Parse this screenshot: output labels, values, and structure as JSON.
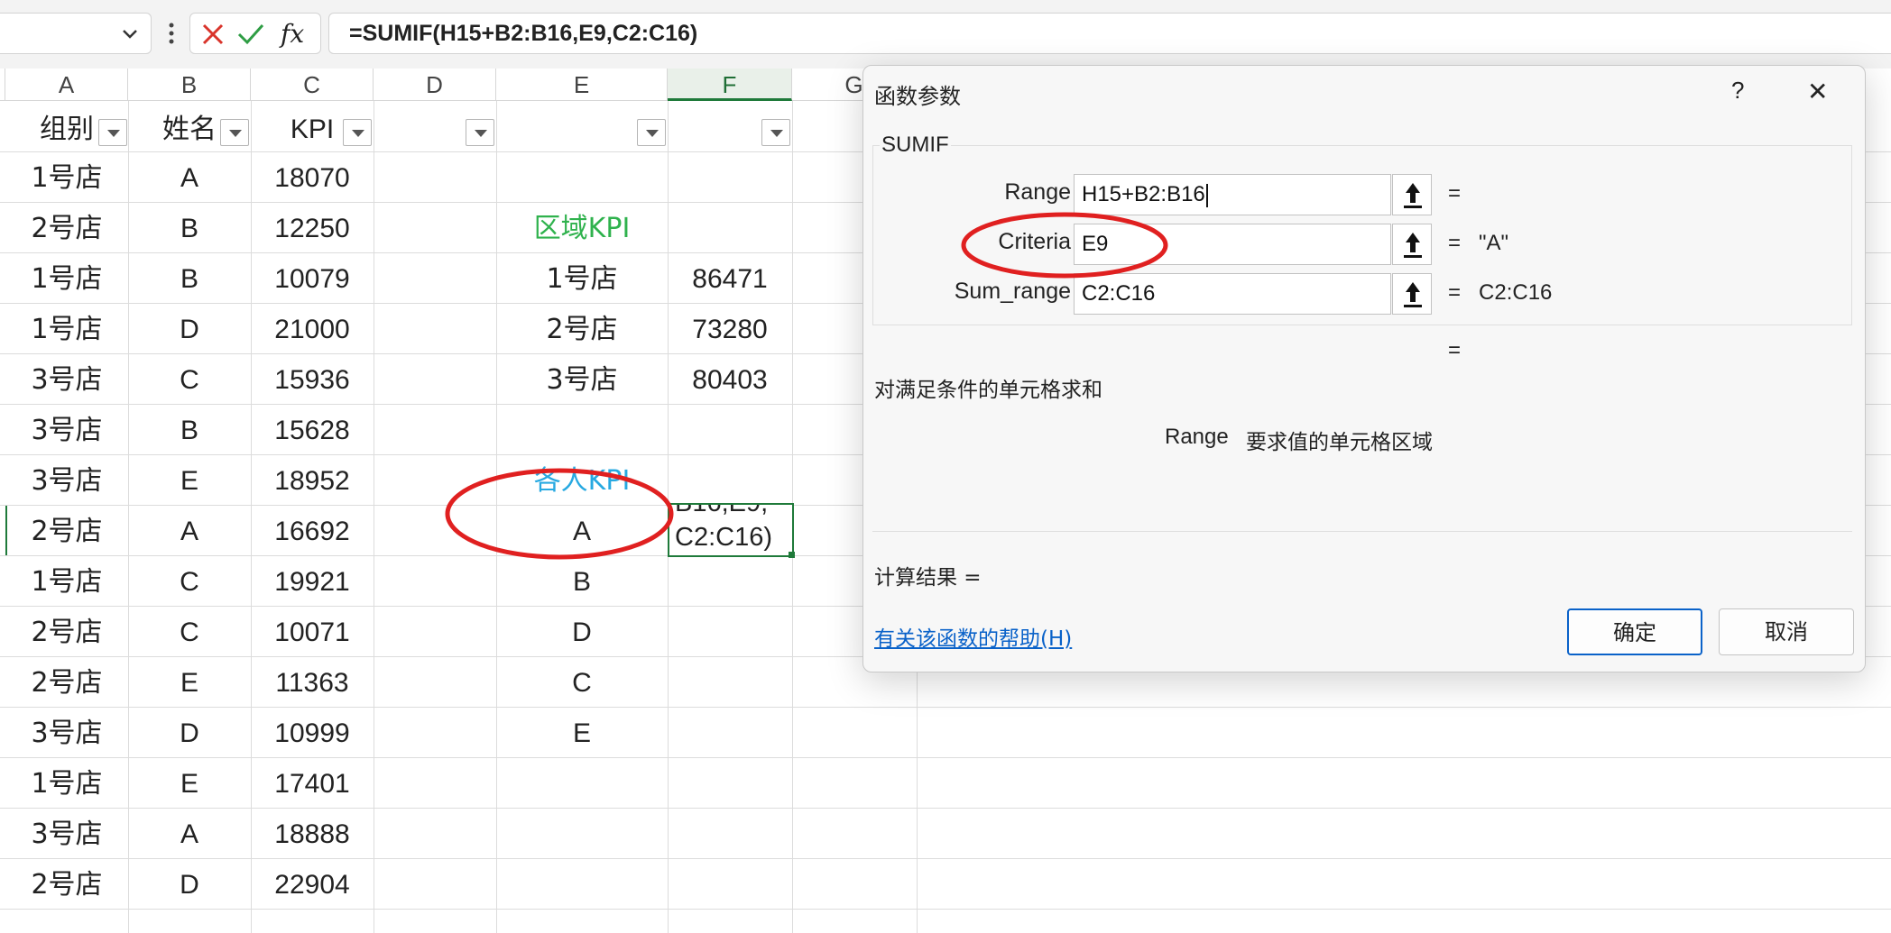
{
  "formula_bar": {
    "name_box": "",
    "formula": "=SUMIF(H15+B2:B16,E9,C2:C16)"
  },
  "columns": [
    "A",
    "B",
    "C",
    "D",
    "E",
    "F",
    "G"
  ],
  "headers": [
    "组别",
    "姓名",
    "KPI"
  ],
  "rows": [
    [
      "1号店",
      "A",
      "18070"
    ],
    [
      "2号店",
      "B",
      "12250"
    ],
    [
      "1号店",
      "B",
      "10079"
    ],
    [
      "1号店",
      "D",
      "21000"
    ],
    [
      "3号店",
      "C",
      "15936"
    ],
    [
      "3号店",
      "B",
      "15628"
    ],
    [
      "3号店",
      "E",
      "18952"
    ],
    [
      "2号店",
      "A",
      "16692"
    ],
    [
      "1号店",
      "C",
      "19921"
    ],
    [
      "2号店",
      "C",
      "10071"
    ],
    [
      "2号店",
      "E",
      "11363"
    ],
    [
      "3号店",
      "D",
      "10999"
    ],
    [
      "1号店",
      "E",
      "17401"
    ],
    [
      "3号店",
      "A",
      "18888"
    ],
    [
      "2号店",
      "D",
      "22904"
    ]
  ],
  "region_kpi": {
    "title": "区域KPI",
    "stores": [
      "1号店",
      "2号店",
      "3号店"
    ],
    "values": [
      "86471",
      "73280",
      "80403"
    ]
  },
  "person_kpi": {
    "title": "各人KPI",
    "names": [
      "A",
      "B",
      "D",
      "C",
      "E"
    ],
    "editing_line1": "B16,E9,",
    "editing_line2": "C2:C16)"
  },
  "dialog": {
    "title": "函数参数",
    "help_glyph": "?",
    "close_glyph": "✕",
    "function_name": "SUMIF",
    "args": [
      {
        "label": "Range",
        "value": "H15+B2:B16",
        "result": "="
      },
      {
        "label": "Criteria",
        "value": "E9",
        "result": "=   \"A\""
      },
      {
        "label": "Sum_range",
        "value": "C2:C16",
        "result": "=   C2:C16"
      }
    ],
    "total_eq": "=",
    "description": "对满足条件的单元格求和",
    "arg_name": "Range",
    "arg_desc": "要求值的单元格区域",
    "result_label": "计算结果 =",
    "help_link": "有关该函数的帮助(H)",
    "ok_label": "确定",
    "cancel_label": "取消"
  },
  "colors": {
    "accent_green": "#1f9d55",
    "title_green": "#2fb24d",
    "title_cyan": "#27a9e1",
    "annotation_red": "#e02020",
    "link_blue": "#0a62c9"
  }
}
